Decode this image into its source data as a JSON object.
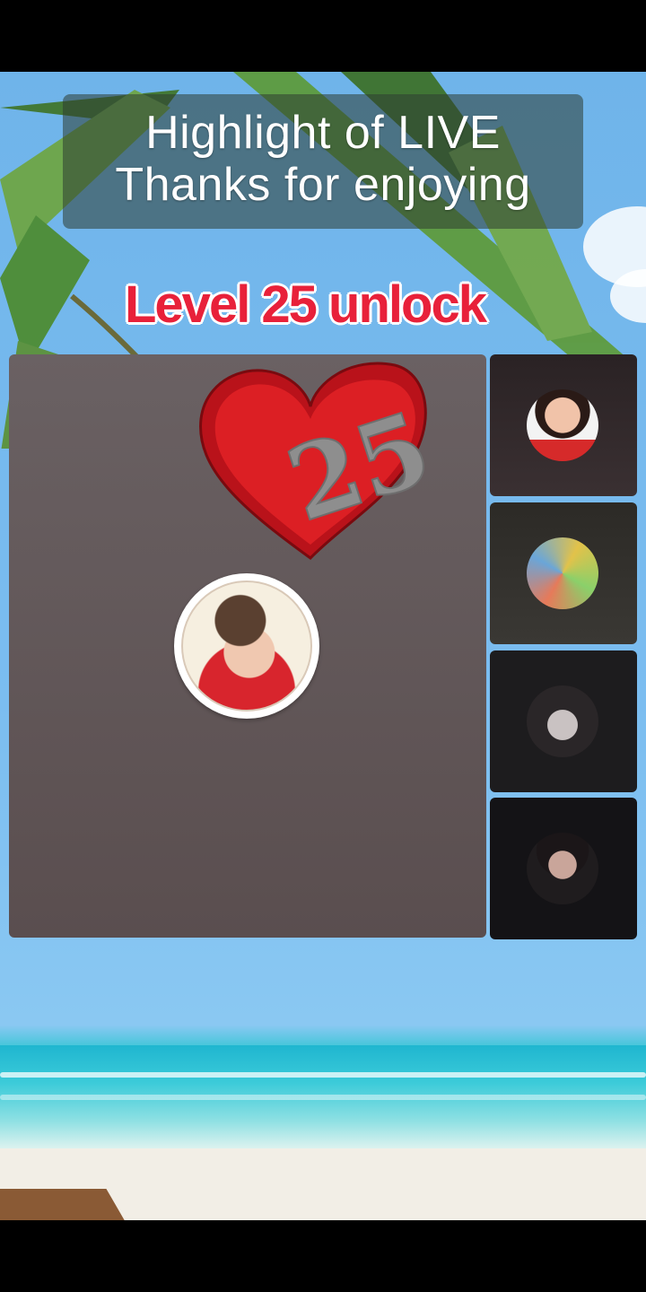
{
  "overlay": {
    "title_line1": "Highlight of LIVE",
    "title_line2": "Thanks for enjoying",
    "level_text": "Level 25 unlock"
  },
  "gift": {
    "number": "25",
    "icon": "heart-icon",
    "color": "#d0171c"
  },
  "host": {
    "avatar": "host-avatar"
  },
  "guests": [
    {
      "avatar": "guest-avatar-1"
    },
    {
      "avatar": "guest-avatar-2"
    },
    {
      "avatar": "guest-avatar-3"
    },
    {
      "avatar": "guest-avatar-4"
    }
  ],
  "colors": {
    "level_text": "#e8213a",
    "panel": "#5f5556",
    "sky": "#7bbdf0",
    "sea": "#2fc0d4"
  }
}
